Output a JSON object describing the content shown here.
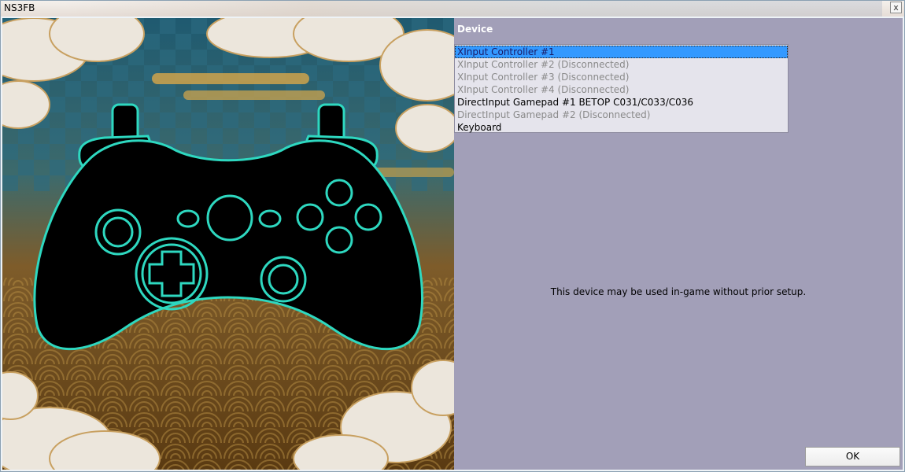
{
  "window": {
    "title": "NS3FB",
    "close_symbol": "x"
  },
  "device_section": {
    "label": "Device",
    "items": [
      {
        "label": "XInput Controller #1",
        "state": "selected"
      },
      {
        "label": "XInput Controller #2 (Disconnected)",
        "state": "disconnected"
      },
      {
        "label": "XInput Controller #3 (Disconnected)",
        "state": "disconnected"
      },
      {
        "label": "XInput Controller #4 (Disconnected)",
        "state": "disconnected"
      },
      {
        "label": "DirectInput Gamepad #1 BETOP C031/C033/C036",
        "state": "normal"
      },
      {
        "label": "DirectInput Gamepad #2 (Disconnected)",
        "state": "disconnected"
      },
      {
        "label": "Keyboard",
        "state": "normal"
      }
    ]
  },
  "info_text": "This device may be used in-game without prior setup.",
  "ok_label": "OK",
  "colors": {
    "panel_background": "#a29fb8",
    "selection": "#3399ff",
    "controller_outline": "#2ed8c0"
  },
  "icons": {
    "controller_art": "gamepad-icon"
  }
}
